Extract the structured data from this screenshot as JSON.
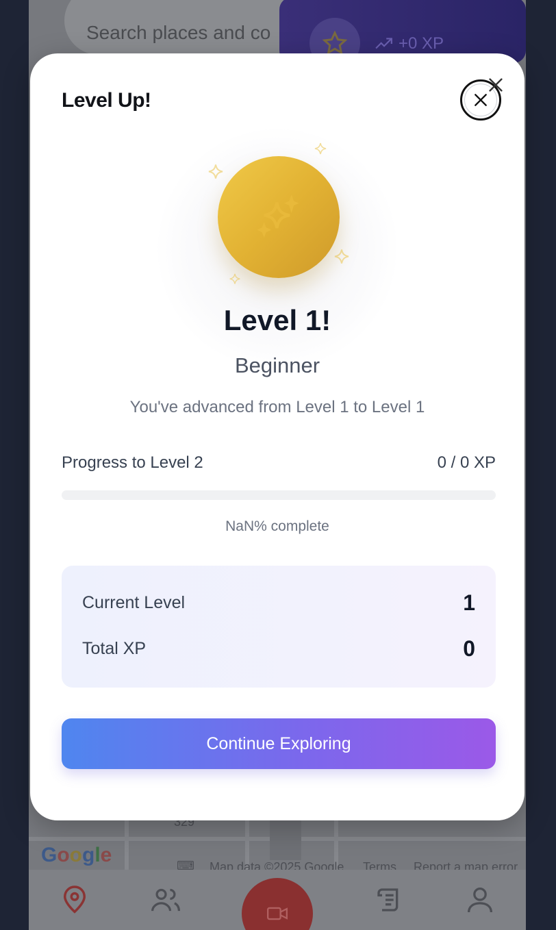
{
  "background": {
    "search_placeholder": "Search places and co",
    "xp_badge": "+0 XP",
    "map_number": "329",
    "map_attribution": "Map data ©2025 Google",
    "terms": "Terms",
    "report": "Report a map error",
    "google_letters": [
      "G",
      "o",
      "o",
      "g",
      "l",
      "e"
    ]
  },
  "modal": {
    "title": "Level Up!",
    "level_heading": "Level 1!",
    "level_name": "Beginner",
    "advanced_text": "You've advanced from Level 1 to Level 1",
    "progress_label": "Progress to Level 2",
    "progress_xp": "0 / 0 XP",
    "progress_fraction": 0,
    "progress_percent_text": "NaN% complete",
    "stats": {
      "current_level_label": "Current Level",
      "current_level_value": "1",
      "total_xp_label": "Total XP",
      "total_xp_value": "0"
    },
    "continue_label": "Continue Exploring"
  },
  "colors": {
    "accent_gradient_start": "#4f86ef",
    "accent_gradient_end": "#9b59e8",
    "coin_gold": "#e2b233",
    "overlay": "#1e2435"
  },
  "icons": {
    "close": "close-icon",
    "coin_sparkle": "sparkles-icon",
    "nav": [
      "map-pin-icon",
      "users-icon",
      "video-camera-icon",
      "scroll-icon",
      "user-icon"
    ]
  }
}
